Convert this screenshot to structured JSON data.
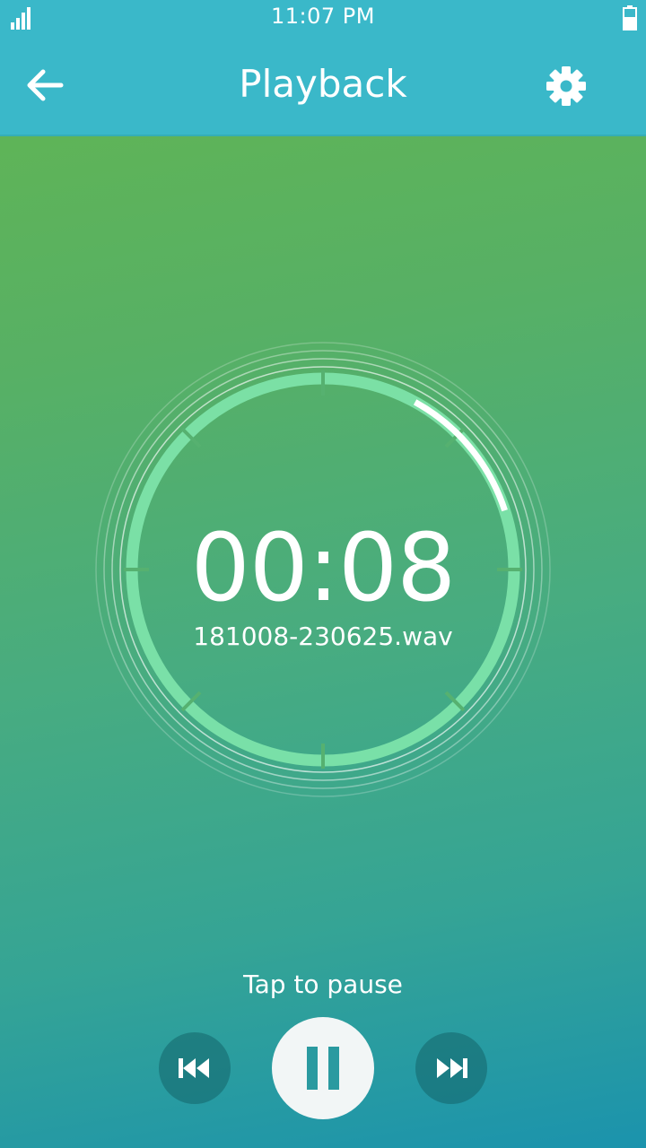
{
  "status_bar": {
    "time": "11:07 PM",
    "signal_icon": "signal-strength-icon",
    "battery_icon": "battery-icon"
  },
  "app_bar": {
    "title": "Playback",
    "back_icon": "arrow-left-icon",
    "settings_icon": "gear-icon"
  },
  "player": {
    "elapsed": "00:08",
    "file_name": "181008-230625.wav",
    "progress_fraction": 0.12,
    "hint": "Tap to pause"
  },
  "controls": {
    "rewind_icon": "skip-previous-icon",
    "pause_icon": "pause-icon",
    "forward_icon": "skip-next-icon"
  },
  "colors": {
    "app_bar": "#3ab8c9",
    "gradient_top": "#63b650",
    "gradient_bottom": "#1b93ad",
    "ring": "#7fe6ac",
    "progress": "#ffffff"
  }
}
